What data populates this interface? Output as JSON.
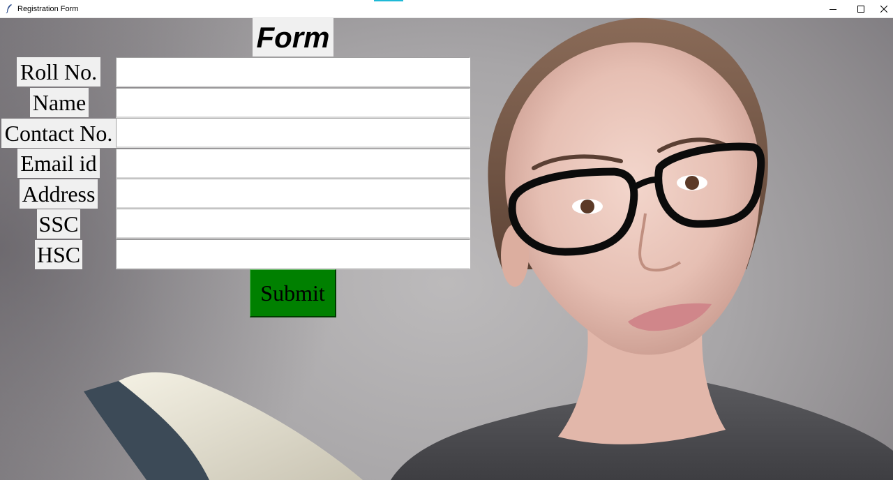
{
  "window": {
    "title": "Registration Form"
  },
  "form": {
    "heading": "Form",
    "fields": [
      {
        "label": "Roll No.",
        "value": ""
      },
      {
        "label": "Name",
        "value": ""
      },
      {
        "label": "Contact No.",
        "value": ""
      },
      {
        "label": "Email id",
        "value": ""
      },
      {
        "label": "Address",
        "value": ""
      },
      {
        "label": "SSC",
        "value": ""
      },
      {
        "label": "HSC",
        "value": ""
      }
    ],
    "submit_label": "Submit"
  },
  "icons": {
    "app": "feather-icon",
    "minimize": "minimize-icon",
    "maximize": "maximize-icon",
    "close": "close-icon"
  },
  "colors": {
    "submit_bg": "#008000",
    "label_bg": "#f0f0f0",
    "input_bg": "#ffffff"
  }
}
